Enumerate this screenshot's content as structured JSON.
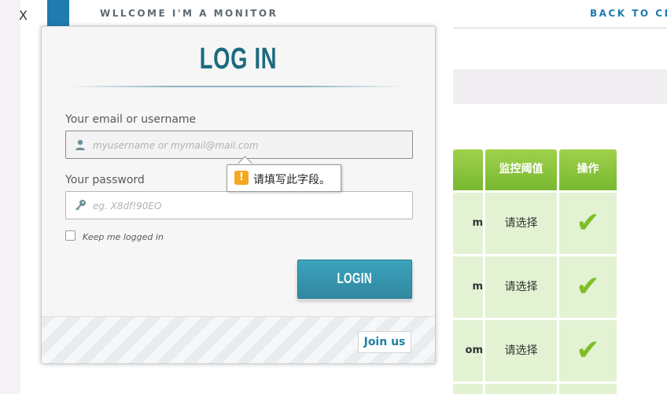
{
  "header": {
    "close_label": "X",
    "welcome_text": "WLLCOME I'M A MONITOR",
    "back_link": "BACK TO CL"
  },
  "background_table": {
    "headers": [
      "监控阈值",
      "操作"
    ],
    "rows": [
      {
        "email_tail": "m",
        "threshold": "请选择",
        "action_icon": "check-icon"
      },
      {
        "email_tail": "m",
        "threshold": "请选择",
        "action_icon": "check-icon"
      },
      {
        "email_tail": "om",
        "threshold": "请选择",
        "action_icon": "check-icon"
      }
    ],
    "colors": {
      "header": "#8cc63f",
      "cell": "#e2f2d3",
      "check": "#7fbf25"
    }
  },
  "login": {
    "title": "LOG IN",
    "username_label": "Your email or username",
    "username_placeholder": "myusername or mymail@mail.com",
    "password_label": "Your password",
    "password_placeholder": "eg. X8df!90EO",
    "keep_logged_in": "Keep me logged in",
    "submit_label": "LOGIN",
    "join_label": "Join us",
    "validation_message": "请填写此字段。",
    "colors": {
      "title": "#1d6a7f",
      "button": "#3596ae",
      "link": "#1f7fa3"
    }
  }
}
